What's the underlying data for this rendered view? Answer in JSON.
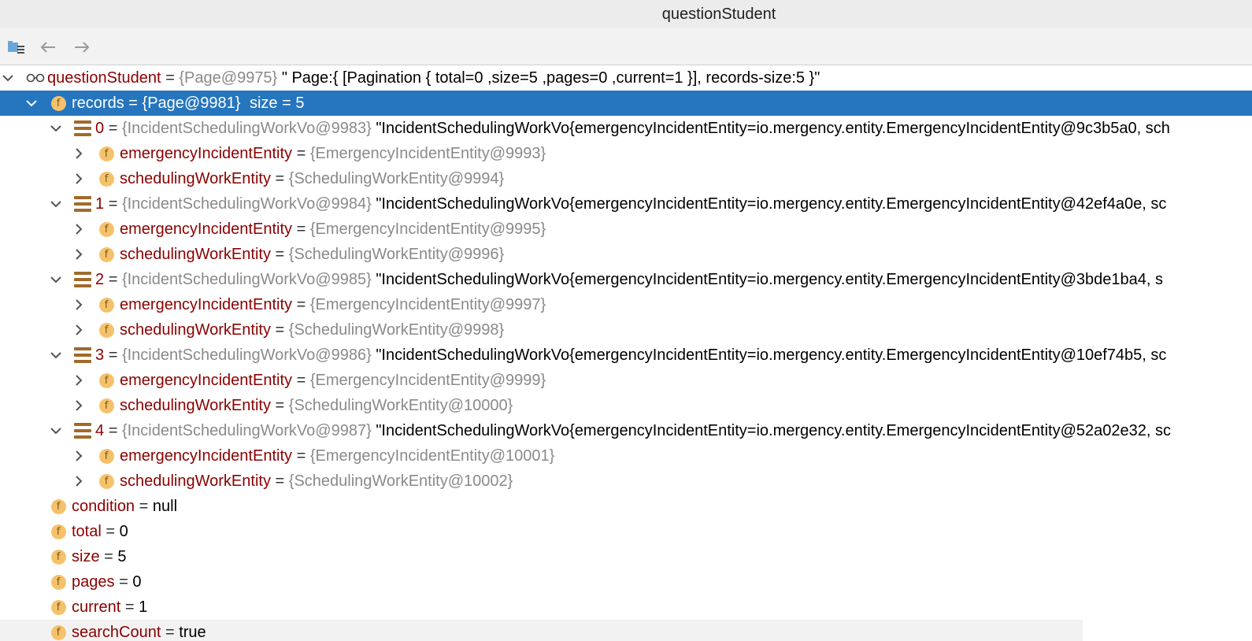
{
  "window": {
    "title": "questionStudent"
  },
  "toolbar": {
    "icons": [
      "folder-list-icon",
      "back-arrow-icon",
      "forward-arrow-icon"
    ]
  },
  "tree": {
    "root": {
      "name": "questionStudent",
      "eq": "=",
      "ref": "{Page@9975}",
      "str": "\" Page:{ [Pagination { total=0 ,size=5 ,pages=0 ,current=1 }], records-size:5 }\""
    },
    "records": {
      "name": "records",
      "eq": "=",
      "ref": "{Page@9981}",
      "extra": "size = 5"
    },
    "items": [
      {
        "index": "0",
        "eq": "=",
        "ref": "{IncidentSchedulingWorkVo@9983}",
        "str": "\"IncidentSchedulingWorkVo{emergencyIncidentEntity=io.mergency.entity.EmergencyIncidentEntity@9c3b5a0, sch",
        "emergency": {
          "name": "emergencyIncidentEntity",
          "eq": "=",
          "ref": "{EmergencyIncidentEntity@9993}"
        },
        "scheduling": {
          "name": "schedulingWorkEntity",
          "eq": "=",
          "ref": "{SchedulingWorkEntity@9994}"
        }
      },
      {
        "index": "1",
        "eq": "=",
        "ref": "{IncidentSchedulingWorkVo@9984}",
        "str": "\"IncidentSchedulingWorkVo{emergencyIncidentEntity=io.mergency.entity.EmergencyIncidentEntity@42ef4a0e, sc",
        "emergency": {
          "name": "emergencyIncidentEntity",
          "eq": "=",
          "ref": "{EmergencyIncidentEntity@9995}"
        },
        "scheduling": {
          "name": "schedulingWorkEntity",
          "eq": "=",
          "ref": "{SchedulingWorkEntity@9996}"
        }
      },
      {
        "index": "2",
        "eq": "=",
        "ref": "{IncidentSchedulingWorkVo@9985}",
        "str": "\"IncidentSchedulingWorkVo{emergencyIncidentEntity=io.mergency.entity.EmergencyIncidentEntity@3bde1ba4, s",
        "emergency": {
          "name": "emergencyIncidentEntity",
          "eq": "=",
          "ref": "{EmergencyIncidentEntity@9997}"
        },
        "scheduling": {
          "name": "schedulingWorkEntity",
          "eq": "=",
          "ref": "{SchedulingWorkEntity@9998}"
        }
      },
      {
        "index": "3",
        "eq": "=",
        "ref": "{IncidentSchedulingWorkVo@9986}",
        "str": "\"IncidentSchedulingWorkVo{emergencyIncidentEntity=io.mergency.entity.EmergencyIncidentEntity@10ef74b5, sc",
        "emergency": {
          "name": "emergencyIncidentEntity",
          "eq": "=",
          "ref": "{EmergencyIncidentEntity@9999}"
        },
        "scheduling": {
          "name": "schedulingWorkEntity",
          "eq": "=",
          "ref": "{SchedulingWorkEntity@10000}"
        }
      },
      {
        "index": "4",
        "eq": "=",
        "ref": "{IncidentSchedulingWorkVo@9987}",
        "str": "\"IncidentSchedulingWorkVo{emergencyIncidentEntity=io.mergency.entity.EmergencyIncidentEntity@52a02e32, sc",
        "emergency": {
          "name": "emergencyIncidentEntity",
          "eq": "=",
          "ref": "{EmergencyIncidentEntity@10001}"
        },
        "scheduling": {
          "name": "schedulingWorkEntity",
          "eq": "=",
          "ref": "{SchedulingWorkEntity@10002}"
        }
      }
    ],
    "fields": [
      {
        "name": "condition",
        "eq": "=",
        "value": "null"
      },
      {
        "name": "total",
        "eq": "=",
        "value": "0"
      },
      {
        "name": "size",
        "eq": "=",
        "value": "5"
      },
      {
        "name": "pages",
        "eq": "=",
        "value": "0"
      },
      {
        "name": "current",
        "eq": "=",
        "value": "1"
      },
      {
        "name": "searchCount",
        "eq": "=",
        "value": "true"
      }
    ],
    "field_badge": "f",
    "colors": {
      "selection": "#2675bf",
      "field_name": "#8b0000",
      "ref": "#8a8a8a",
      "badge": "#f5c26b"
    }
  }
}
